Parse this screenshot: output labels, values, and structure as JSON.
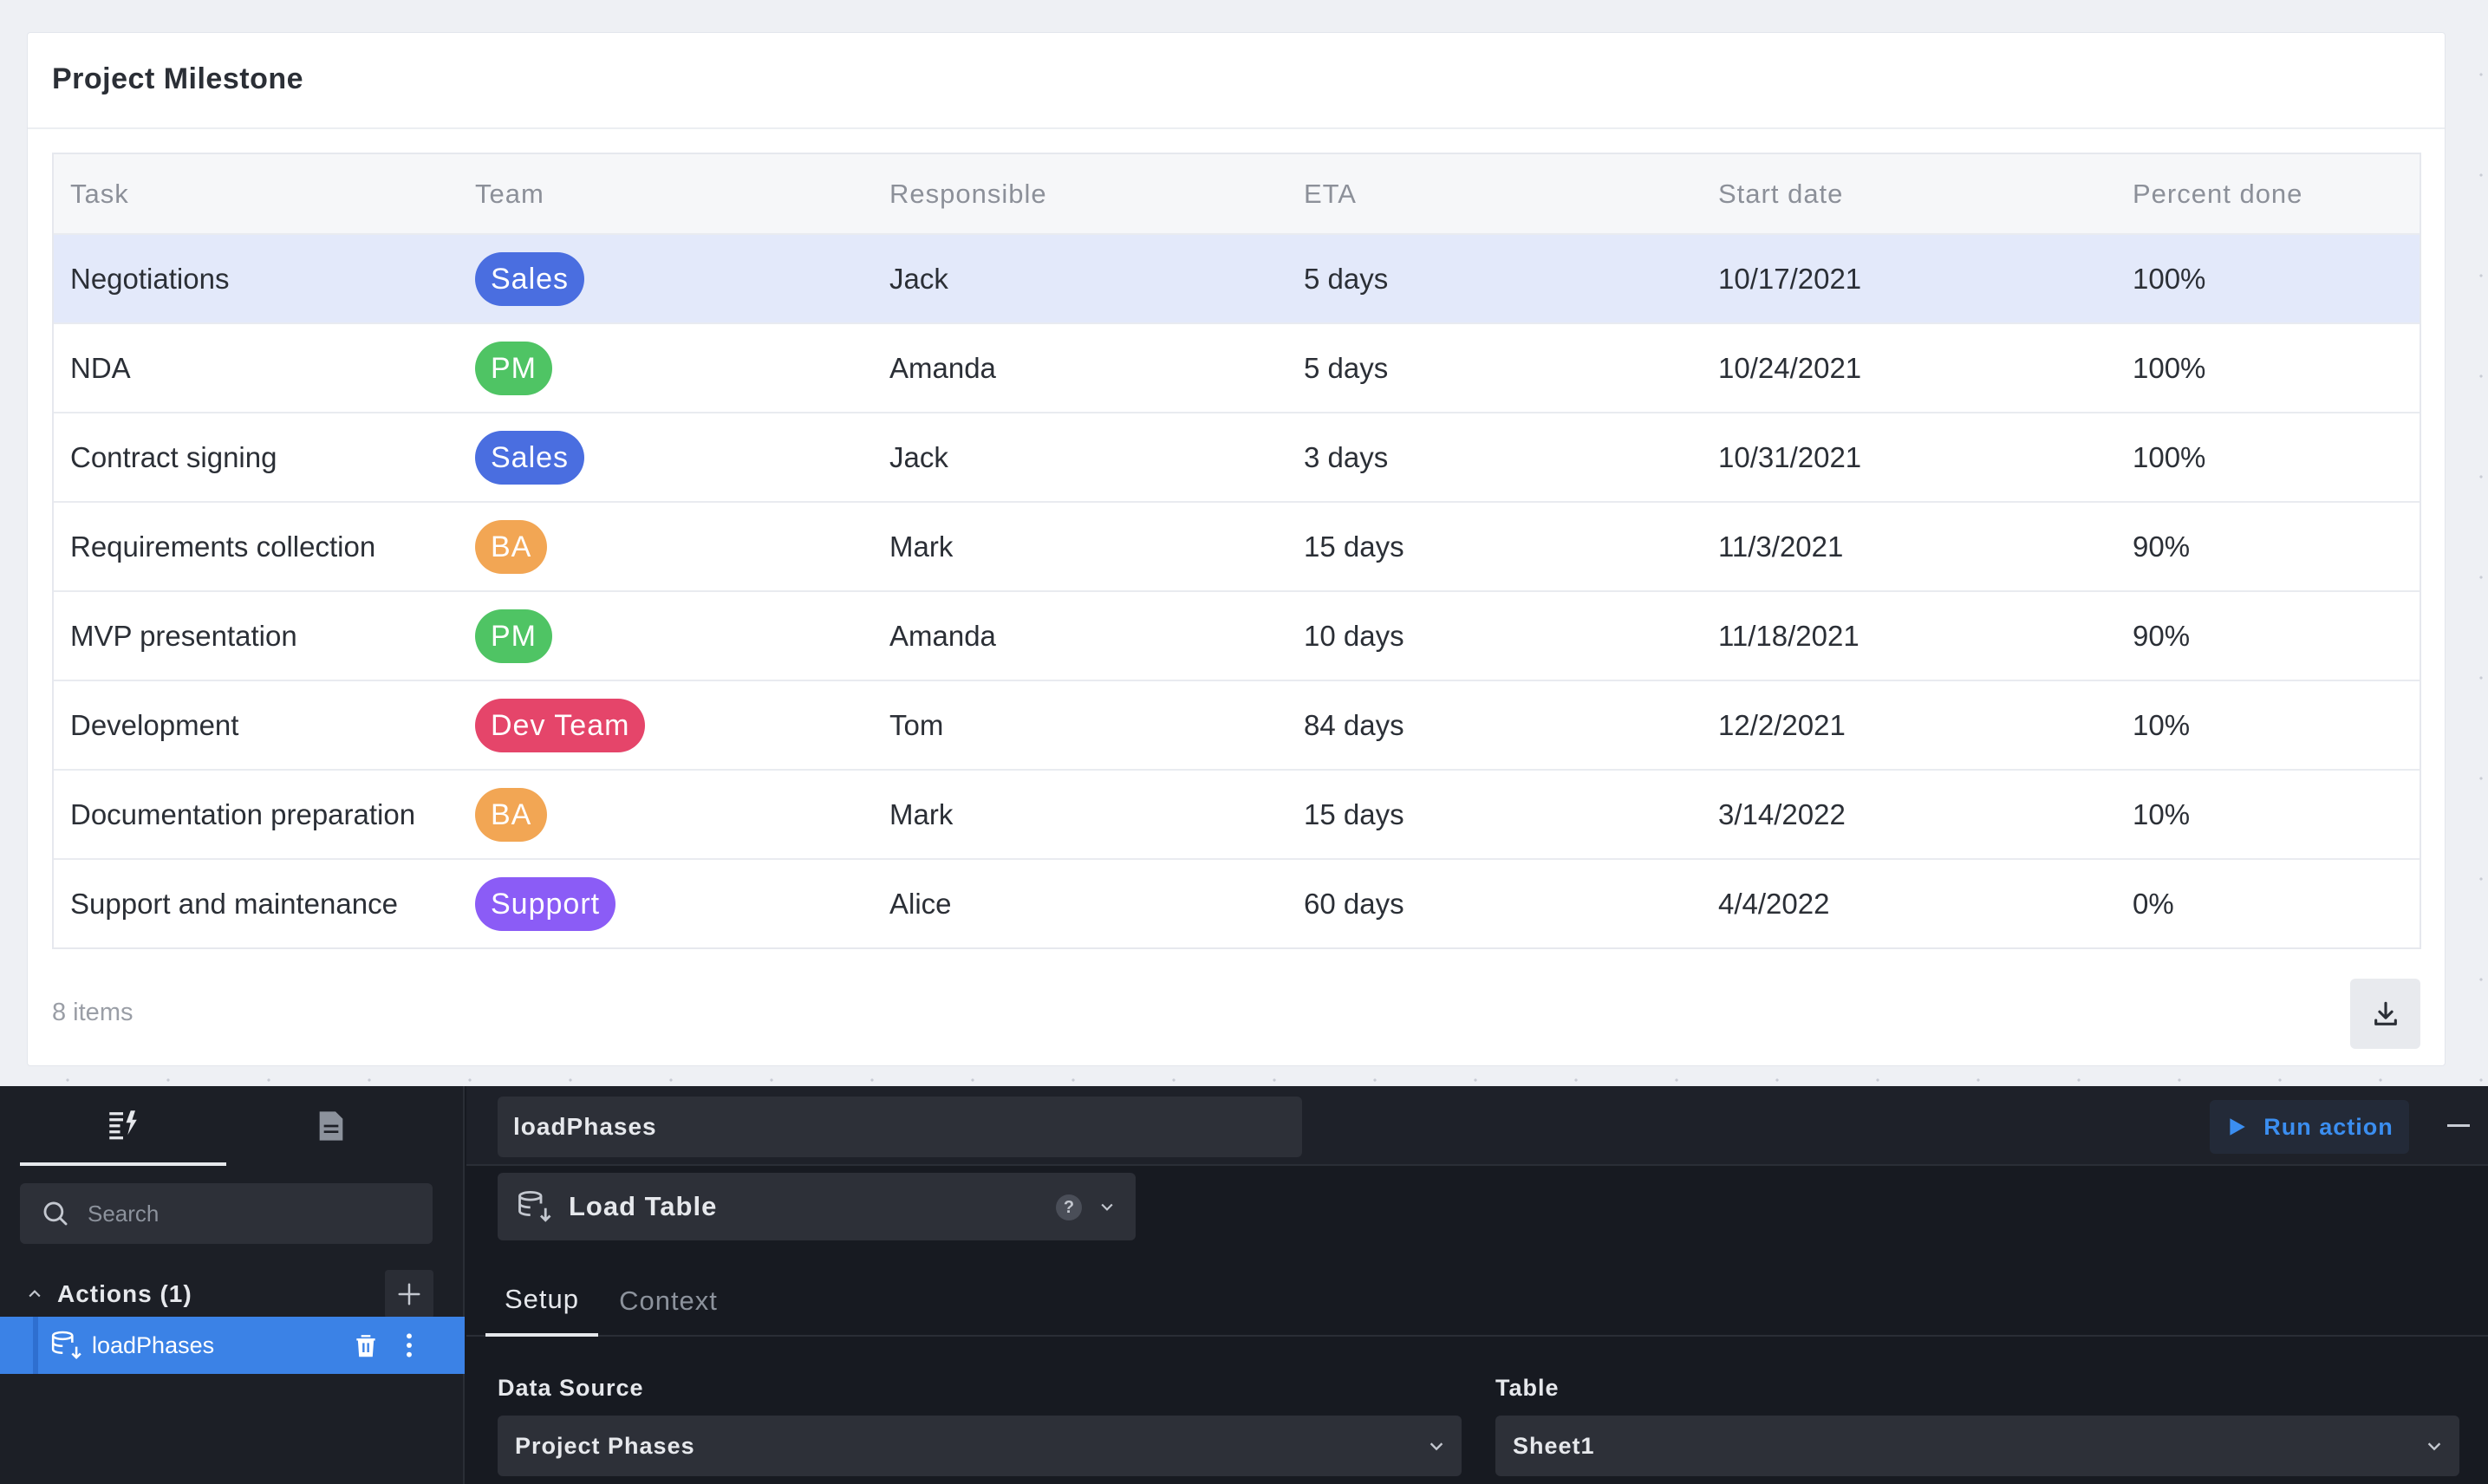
{
  "card": {
    "title": "Project Milestone",
    "items_count": "8 items"
  },
  "table": {
    "columns": [
      "Task",
      "Team",
      "Responsible",
      "ETA",
      "Start date",
      "Percent done"
    ],
    "rows": [
      {
        "task": "Negotiations",
        "team": "Sales",
        "team_color": "#4a6ee0",
        "responsible": "Jack",
        "eta": "5 days",
        "start": "10/17/2021",
        "percent": "100%"
      },
      {
        "task": "NDA",
        "team": "PM",
        "team_color": "#4fc464",
        "responsible": "Amanda",
        "eta": "5 days",
        "start": "10/24/2021",
        "percent": "100%"
      },
      {
        "task": "Contract signing",
        "team": "Sales",
        "team_color": "#4a6ee0",
        "responsible": "Jack",
        "eta": "3 days",
        "start": "10/31/2021",
        "percent": "100%"
      },
      {
        "task": "Requirements collection",
        "team": "BA",
        "team_color": "#f2a654",
        "responsible": "Mark",
        "eta": "15 days",
        "start": "11/3/2021",
        "percent": "90%"
      },
      {
        "task": "MVP presentation",
        "team": "PM",
        "team_color": "#4fc464",
        "responsible": "Amanda",
        "eta": "10 days",
        "start": "11/18/2021",
        "percent": "90%"
      },
      {
        "task": "Development",
        "team": "Dev Team",
        "team_color": "#e5456a",
        "responsible": "Tom",
        "eta": "84 days",
        "start": "12/2/2021",
        "percent": "10%"
      },
      {
        "task": "Documentation preparation",
        "team": "BA",
        "team_color": "#f2a654",
        "responsible": "Mark",
        "eta": "15 days",
        "start": "3/14/2022",
        "percent": "10%"
      },
      {
        "task": "Support and maintenance",
        "team": "Support",
        "team_color": "#8b5cf6",
        "responsible": "Alice",
        "eta": "60 days",
        "start": "4/4/2022",
        "percent": "0%"
      }
    ]
  },
  "panel": {
    "search_placeholder": "Search",
    "actions_label": "Actions (1)",
    "action_items": [
      {
        "label": "loadPhases"
      }
    ],
    "action_name": "loadPhases",
    "run_label": "Run action",
    "action_type": "Load Table",
    "help_label": "?",
    "tabs": [
      {
        "label": "Setup"
      },
      {
        "label": "Context"
      }
    ],
    "data_source_label": "Data Source",
    "data_source_value": "Project Phases",
    "table_label": "Table",
    "table_value": "Sheet1"
  },
  "colors": {
    "accent": "#3b82e6",
    "selected_row": "#e3e9fa"
  }
}
